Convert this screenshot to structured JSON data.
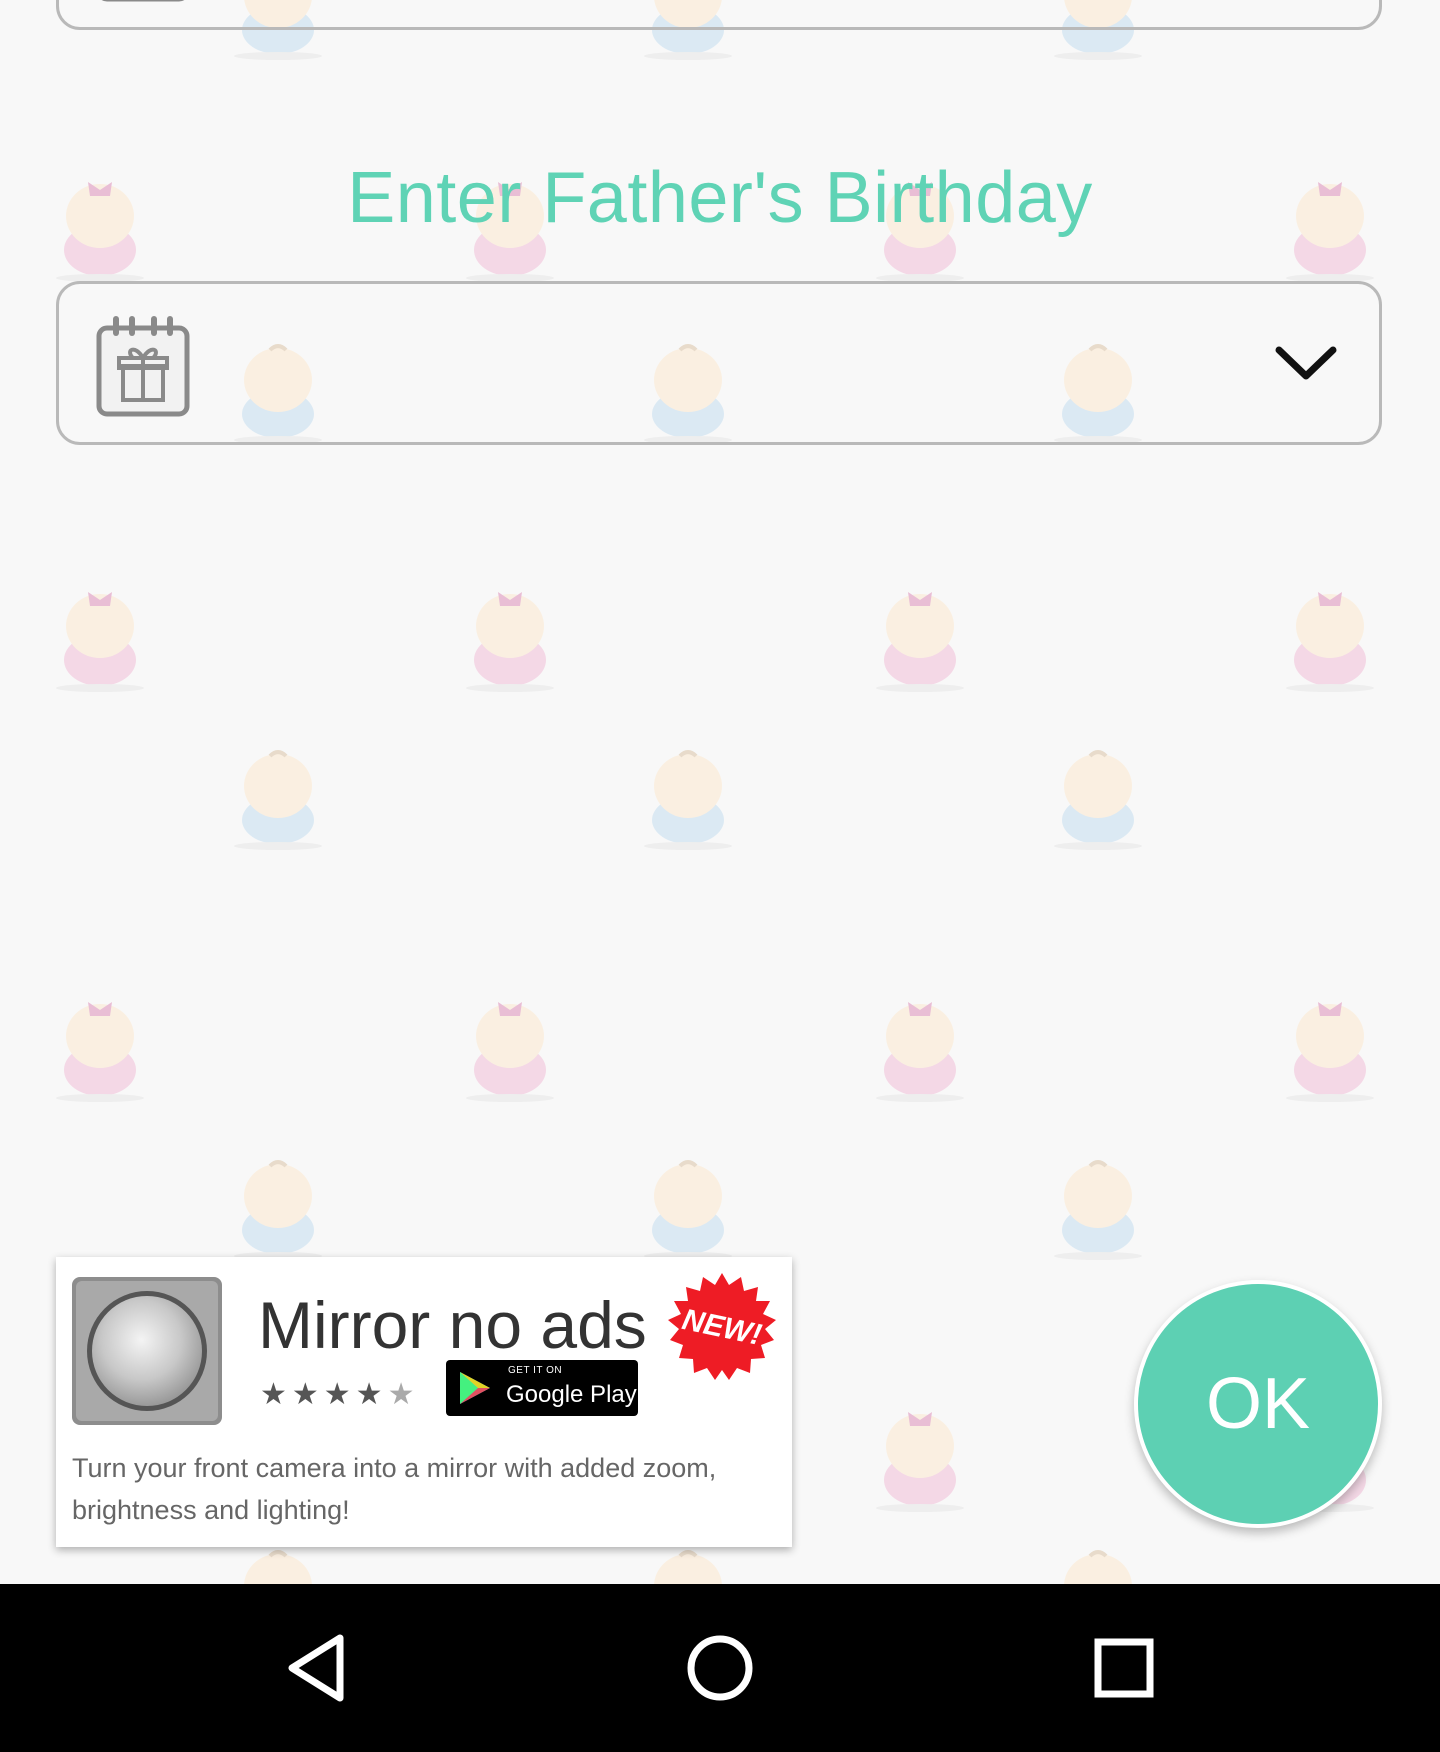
{
  "screen": {
    "heading": "Enter Father's Birthday"
  },
  "birthday_field": {
    "value": "",
    "icon": "calendar-gift-icon",
    "dropdown_icon": "chevron-down-icon"
  },
  "ad": {
    "title": "Mirror no ads",
    "rating_stars": 4.5,
    "badge_new": "NEW!",
    "store_badge_small": "GET IT ON",
    "store_badge_big": "Google Play",
    "description": "Turn your front camera into a mirror with added zoom, brightness and lighting!",
    "icon": "mirror-app-icon"
  },
  "ok_button": {
    "label": "OK"
  },
  "nav": {
    "back": "nav-back-icon",
    "home": "nav-home-icon",
    "recent": "nav-recent-icon"
  },
  "colors": {
    "accent": "#5fd3b5",
    "ok_button": "#5dd0b3",
    "background": "#f8f8f8",
    "new_badge": "#ee1c25",
    "navbar": "#000000"
  }
}
